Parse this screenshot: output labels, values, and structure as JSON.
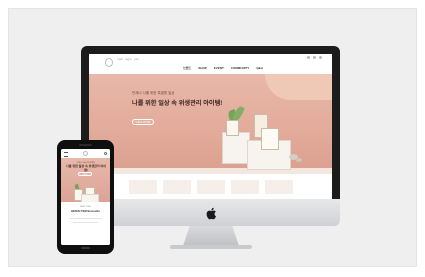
{
  "site": {
    "header_left": "mall · login · join",
    "nav": [
      "브랜드",
      "SHOP",
      "EVENT",
      "COMMUNITY",
      "Q&A"
    ],
    "hero_subtitle": "언제나 나를 위한 특별함 일상",
    "hero_title": "나를 위한 일상 속 위생관리 아이템!",
    "hero_button": "VIEW MORE"
  },
  "mobile": {
    "hero_subtitle": "언제나 나를 위한 특별함",
    "hero_title": "나를 위한 일상 속 위생관리 아이템!",
    "hero_button": "VIEW",
    "caption": "BEST ITEM",
    "headline": "BEZEN ITEM Bestseller"
  },
  "colors": {
    "hero": "#e2aa99",
    "frame": "#1c1c1c",
    "background": "#efefef"
  }
}
